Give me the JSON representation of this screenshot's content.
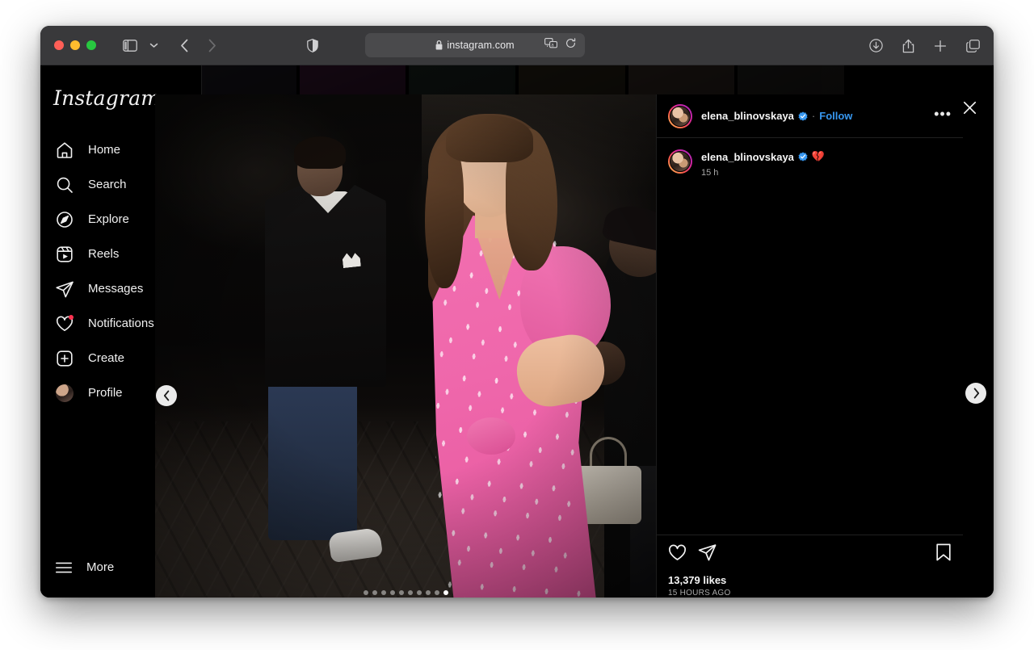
{
  "browser": {
    "url": "instagram.com",
    "icons": {
      "lock": "lock-icon",
      "translate": "translate-icon",
      "reload": "reload-icon",
      "shield": "privacy-shield-icon",
      "sidebar": "sidebar-toggle-icon",
      "chevron_down": "chevron-down-icon",
      "back": "back-arrow-icon",
      "forward": "forward-arrow-icon",
      "download": "download-icon",
      "share": "share-icon",
      "new_tab": "plus-icon",
      "tab_overview": "tab-overview-icon"
    }
  },
  "sidebar": {
    "logo": "Instagram",
    "items": [
      {
        "label": "Home",
        "icon": "home-icon"
      },
      {
        "label": "Search",
        "icon": "search-icon"
      },
      {
        "label": "Explore",
        "icon": "compass-icon"
      },
      {
        "label": "Reels",
        "icon": "reels-icon"
      },
      {
        "label": "Messages",
        "icon": "paper-plane-icon"
      },
      {
        "label": "Notifications",
        "icon": "heart-icon"
      },
      {
        "label": "Create",
        "icon": "plus-square-icon"
      },
      {
        "label": "Profile",
        "icon": "avatar-icon"
      }
    ],
    "more": {
      "label": "More",
      "icon": "hamburger-icon"
    }
  },
  "post": {
    "header": {
      "username": "elena_blinovskaya",
      "verified": true,
      "separator": "·",
      "follow_label": "Follow",
      "menu": "•••"
    },
    "caption": {
      "username": "elena_blinovskaya",
      "verified": true,
      "emoji": "💔",
      "time": "15 h"
    },
    "actions": {
      "like": "heart-icon",
      "share": "paper-plane-icon",
      "save": "bookmark-icon"
    },
    "likes": "13,379 likes",
    "date": "15 HOURS AGO",
    "carousel": {
      "total_dots": 10,
      "active_index": 9,
      "prev_label": "Previous",
      "next_label": "Next"
    },
    "close_label": "Close"
  },
  "colors": {
    "accent_blue": "#3797f0",
    "verified_blue": "#3797f0",
    "notification_dot": "#ff3250",
    "background": "#000000",
    "toolbar": "#39393b"
  }
}
